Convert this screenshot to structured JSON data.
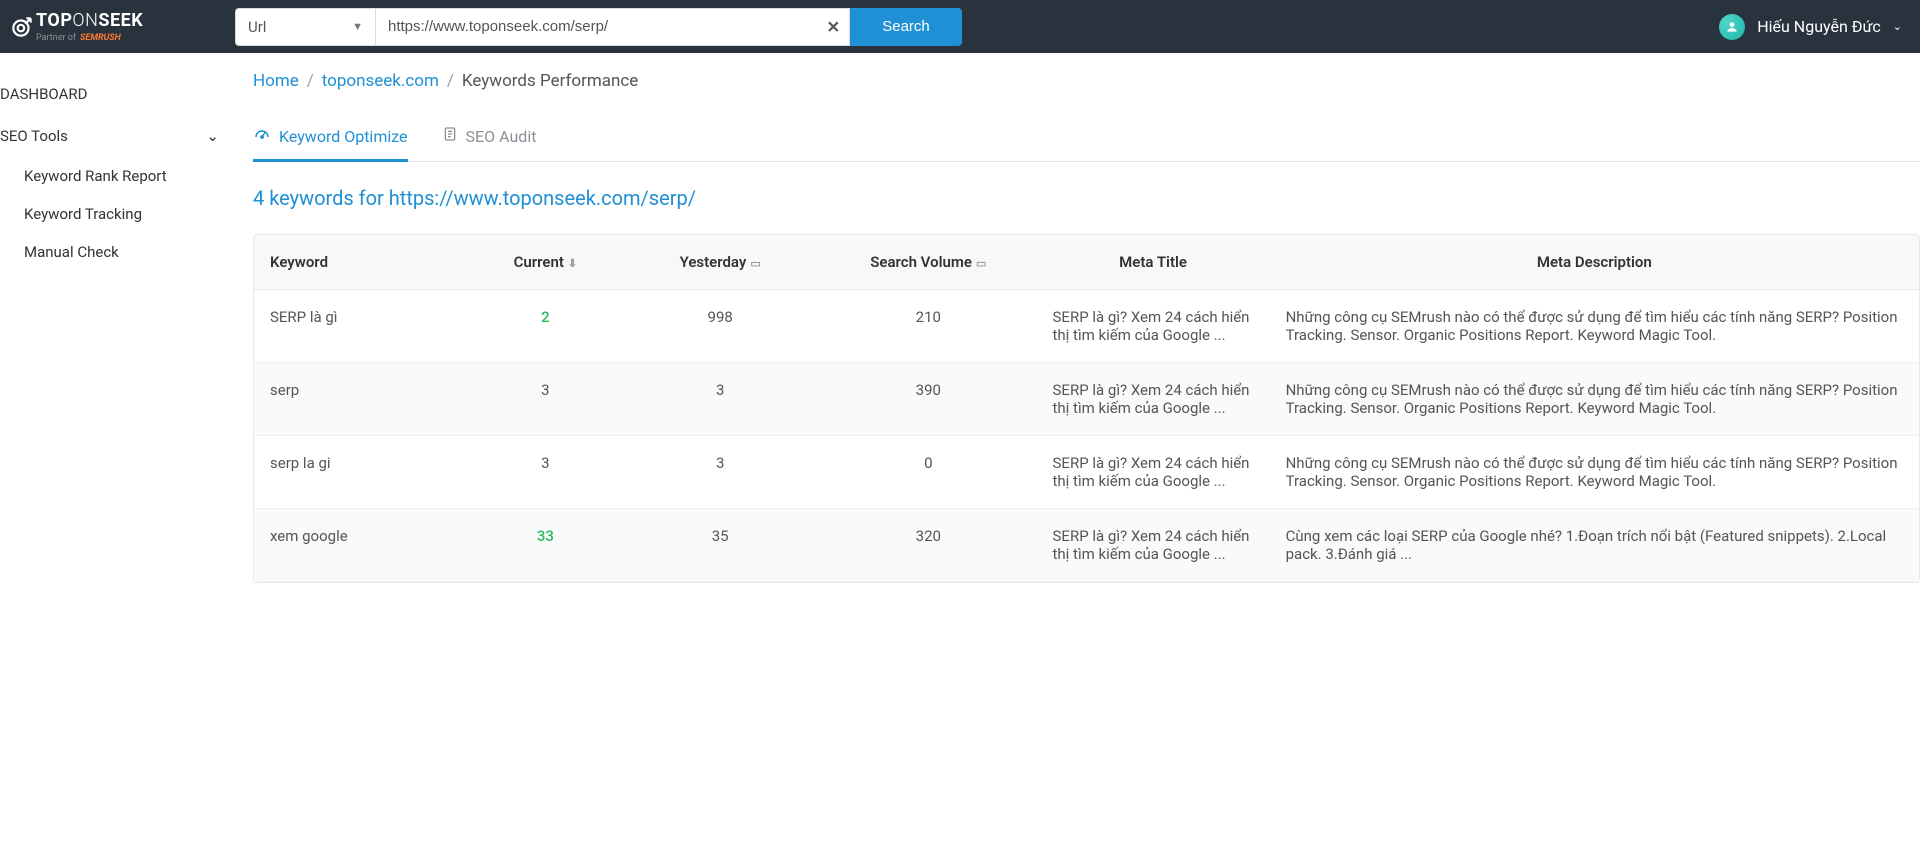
{
  "header": {
    "logo_main_bold": "TOP",
    "logo_main_thin": "ON",
    "logo_main_bold2": "SEEK",
    "logo_sub": "Partner of",
    "logo_sub_brand": "SEMRUSH",
    "select_label": "Url",
    "url_value": "https://www.toponseek.com/serp/",
    "search_label": "Search",
    "user_name": "Hiếu Nguyễn Đức"
  },
  "sidebar": {
    "dashboard": "DASHBOARD",
    "seo_tools": "SEO Tools",
    "items": [
      {
        "label": "Keyword Rank Report"
      },
      {
        "label": "Keyword Tracking"
      },
      {
        "label": "Manual Check"
      }
    ]
  },
  "breadcrumb": {
    "home": "Home",
    "domain": "toponseek.com",
    "current": "Keywords Performance"
  },
  "tabs": {
    "keyword_optimize": "Keyword Optimize",
    "seo_audit": "SEO Audit"
  },
  "summary": "4 keywords for https://www.toponseek.com/serp/",
  "table": {
    "headers": {
      "keyword": "Keyword",
      "current": "Current",
      "yesterday": "Yesterday",
      "search_volume": "Search Volume",
      "meta_title": "Meta Title",
      "meta_description": "Meta Description"
    },
    "rows": [
      {
        "keyword": "SERP là gì",
        "current": "2",
        "current_green": true,
        "yesterday": "998",
        "search_volume": "210",
        "meta_title": "SERP là gì? Xem 24 cách hiển thị tìm kiếm của Google ...",
        "meta_description": "Những công cụ SEMrush nào có thể được sử dụng để tìm hiểu các tính năng SERP? Position Tracking. Sensor. Organic Positions Report. Keyword Magic Tool."
      },
      {
        "keyword": "serp",
        "current": "3",
        "current_green": false,
        "yesterday": "3",
        "search_volume": "390",
        "meta_title": "SERP là gì? Xem 24 cách hiển thị tìm kiếm của Google ...",
        "meta_description": "Những công cụ SEMrush nào có thể được sử dụng để tìm hiểu các tính năng SERP? Position Tracking. Sensor. Organic Positions Report. Keyword Magic Tool."
      },
      {
        "keyword": "serp la gi",
        "current": "3",
        "current_green": false,
        "yesterday": "3",
        "search_volume": "0",
        "meta_title": "SERP là gì? Xem 24 cách hiển thị tìm kiếm của Google ...",
        "meta_description": "Những công cụ SEMrush nào có thể được sử dụng để tìm hiểu các tính năng SERP? Position Tracking. Sensor. Organic Positions Report. Keyword Magic Tool."
      },
      {
        "keyword": "xem google",
        "current": "33",
        "current_green": true,
        "yesterday": "35",
        "search_volume": "320",
        "meta_title": "SERP là gì? Xem 24 cách hiển thị tìm kiếm của Google ...",
        "meta_description": "Cùng xem các loại SERP của Google nhé? 1.Đoạn trích nổi bật (Featured snippets). 2.Local pack. 3.Đánh giá ..."
      }
    ]
  }
}
